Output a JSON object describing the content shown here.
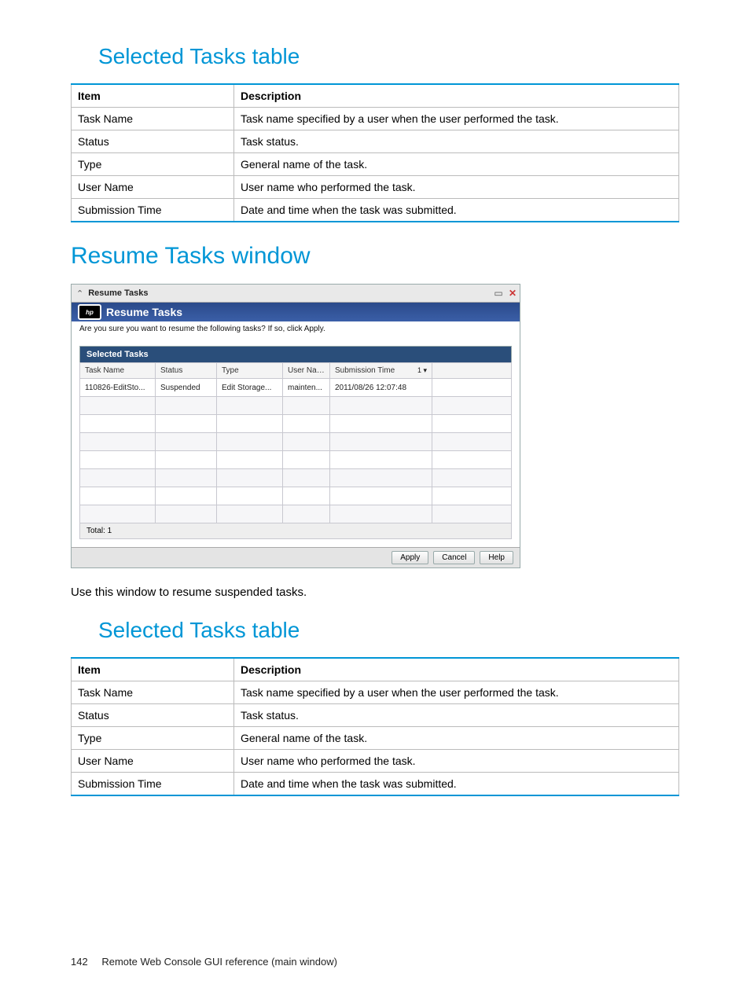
{
  "section1_heading": "Selected Tasks table",
  "table_headers": {
    "item": "Item",
    "description": "Description"
  },
  "desc_rows": [
    {
      "item": "Task Name",
      "desc": "Task name specified by a user when the user performed the task."
    },
    {
      "item": "Status",
      "desc": "Task status."
    },
    {
      "item": "Type",
      "desc": "General name of the task."
    },
    {
      "item": "User Name",
      "desc": "User name who performed the task."
    },
    {
      "item": "Submission Time",
      "desc": "Date and time when the task was submitted."
    }
  ],
  "section2_heading": "Resume Tasks window",
  "win": {
    "titlebar": "Resume Tasks",
    "bluebar": "Resume Tasks",
    "prompt": "Are you sure you want to resume the following tasks? If so, click Apply.",
    "panel_title": "Selected Tasks",
    "cols": {
      "task_name": "Task Name",
      "status": "Status",
      "type": "Type",
      "user_name": "User Name",
      "submission_time": "Submission Time",
      "sort": "1 ▾"
    },
    "row1": {
      "task_name": "110826-EditSto...",
      "status": "Suspended",
      "type": "Edit Storage...",
      "user_name": "mainten...",
      "submission_time": "2011/08/26 12:07:48"
    },
    "footer": "Total: 1",
    "buttons": {
      "apply": "Apply",
      "cancel": "Cancel",
      "help": "Help"
    }
  },
  "body_text": "Use this window to resume suspended tasks.",
  "section3_heading": "Selected Tasks table",
  "footer": {
    "page": "142",
    "text": "Remote Web Console GUI reference (main window)"
  }
}
